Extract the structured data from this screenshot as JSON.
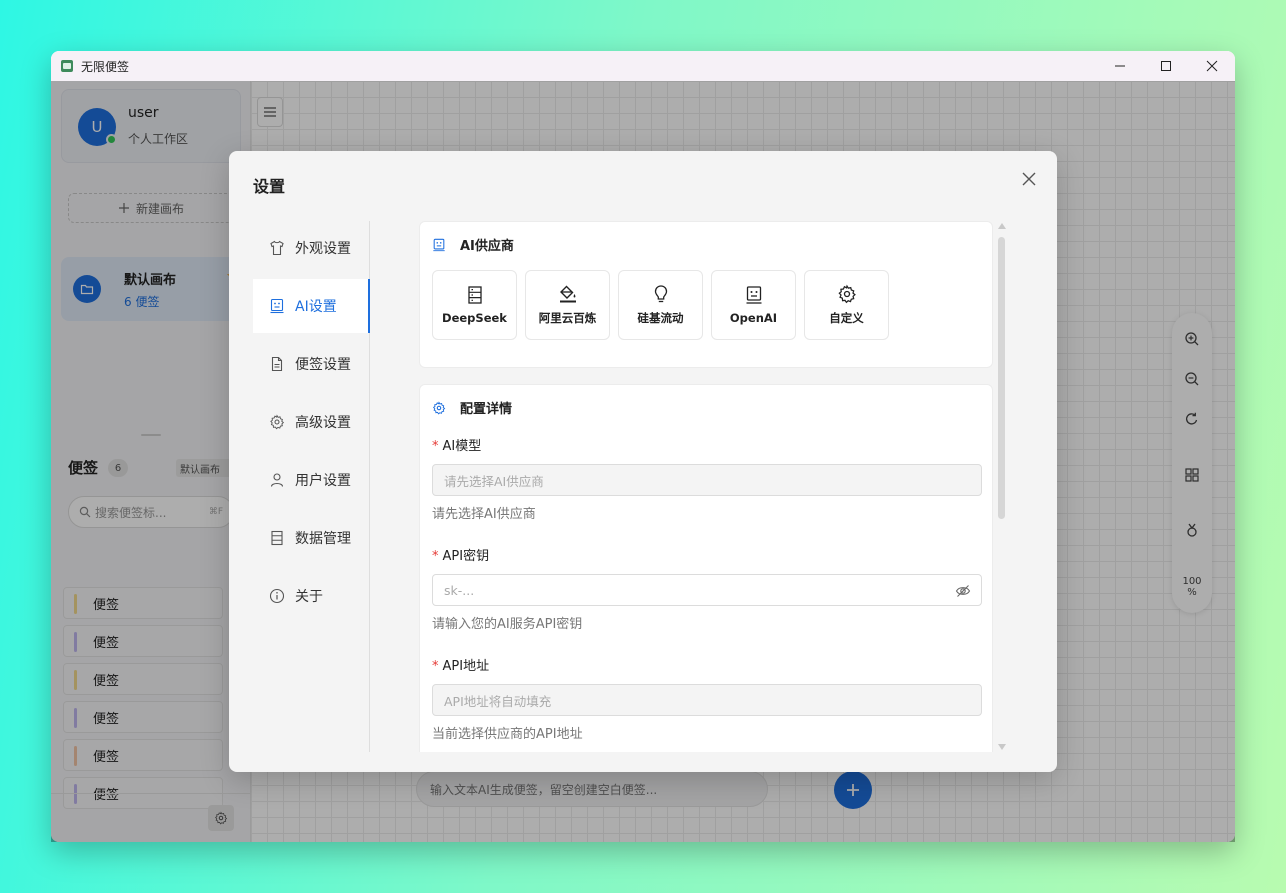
{
  "window": {
    "title": "无限便签"
  },
  "sidebar": {
    "user": {
      "avatar_letter": "U",
      "name": "user",
      "workspace": "个人工作区"
    },
    "new_board_label": "新建画布",
    "board": {
      "name": "默认画布",
      "count": "6 便签"
    },
    "notes": {
      "title": "便签",
      "count": "6",
      "board_tag": "默认画布",
      "search_placeholder": "搜索便签标...",
      "search_shortcut": "⌘F",
      "items": [
        {
          "label": "便签",
          "color": "#f2d98c"
        },
        {
          "label": "便签",
          "color": "#bfb6ee"
        },
        {
          "label": "便签",
          "color": "#f2d98c"
        },
        {
          "label": "便签",
          "color": "#bfb6ee"
        },
        {
          "label": "便签",
          "color": "#f2c4a6"
        },
        {
          "label": "便签",
          "color": "#bfb6ee"
        }
      ]
    }
  },
  "canvas": {
    "zoom_level": "100",
    "zoom_unit": "%",
    "ai_input_placeholder": "输入文本AI生成便签，留空创建空白便签..."
  },
  "settings": {
    "title": "设置",
    "nav": [
      {
        "label": "外观设置",
        "icon": "shirt-icon"
      },
      {
        "label": "AI设置",
        "icon": "robot-icon",
        "active": true
      },
      {
        "label": "便签设置",
        "icon": "document-icon"
      },
      {
        "label": "高级设置",
        "icon": "gear-icon"
      },
      {
        "label": "用户设置",
        "icon": "user-icon"
      },
      {
        "label": "数据管理",
        "icon": "database-icon"
      },
      {
        "label": "关于",
        "icon": "info-icon"
      }
    ],
    "provider_section": {
      "title": "AI供应商",
      "providers": [
        {
          "label": "DeepSeek",
          "icon": "server-icon"
        },
        {
          "label": "阿里云百炼",
          "icon": "paint-bucket-icon"
        },
        {
          "label": "硅基流动",
          "icon": "lightbulb-icon"
        },
        {
          "label": "OpenAI",
          "icon": "robot-icon"
        },
        {
          "label": "自定义",
          "icon": "gear-icon"
        }
      ]
    },
    "config_section": {
      "title": "配置详情",
      "model": {
        "label": "AI模型",
        "placeholder": "请先选择AI供应商",
        "help": "请先选择AI供应商"
      },
      "api_key": {
        "label": "API密钥",
        "placeholder": "sk-...",
        "help": "请输入您的AI服务API密钥"
      },
      "api_url": {
        "label": "API地址",
        "placeholder": "API地址将自动填充",
        "help": "当前选择供应商的API地址"
      }
    }
  },
  "colors": {
    "accent": "#1e6fde",
    "required": "#e53935"
  }
}
